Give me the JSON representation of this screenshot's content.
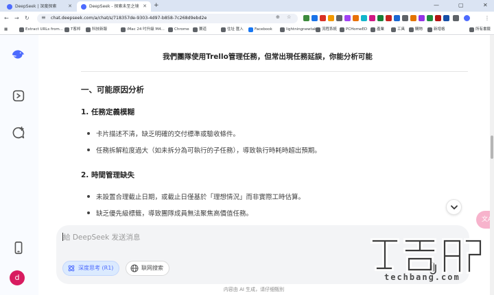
{
  "browser": {
    "tabs": [
      {
        "title": "DeepSeek | 深度探索",
        "active": false
      },
      {
        "title": "DeepSeek - 探索未至之境",
        "active": true
      }
    ],
    "new_tab_icon": "plus-icon",
    "url": "chat.deepseek.com/a/chat/s/718357de-9303-4d97-b858-7c268d9ebd2e",
    "bookmarks": [
      "Extract URLs from...",
      "T客邦",
      "科技新報",
      "iMac 24 吋升級 M4...",
      "Chrome",
      "賽道",
      "住址 匯入",
      "Facebook",
      "lightningnewtab",
      "流程系統",
      "PCHomeED",
      "產業",
      "工具",
      "購物",
      "新增格"
    ],
    "all_bookmarks": "所有書籤"
  },
  "chat": {
    "title": "我們團隊使用Trello管理任務，但常出現任務延誤，你能分析可能",
    "section1": "一、可能原因分析",
    "sub1": "1. 任務定義模糊",
    "sub1_items": [
      "卡片描述不清，缺乏明確的交付標準或驗收條件。",
      "任務拆解粒度過大（如未拆分為可執行的子任務），導致執行時耗時超出預期。"
    ],
    "sub2": "2. 時間管理缺失",
    "sub2_items": [
      "未設置合理截止日期，或截止日僅基於「理想情況」而非實際工時估算。",
      "缺乏優先級標籤，導致團隊成員無法聚焦高價值任務。"
    ]
  },
  "composer": {
    "placeholder": "給 DeepSeek 发送消息",
    "deep_think": "深度思考 (R1)",
    "web_search": "联网搜索"
  },
  "footnote": "内容由 AI 生成，请仔细甄别",
  "avatar_initial": "d",
  "translate_fab": "文A",
  "watermark": {
    "site": "techbang.com"
  },
  "colors": {
    "accent": "#4d6bfe",
    "avatar": "#d81b60",
    "composer_bg": "#f3f4f6"
  }
}
